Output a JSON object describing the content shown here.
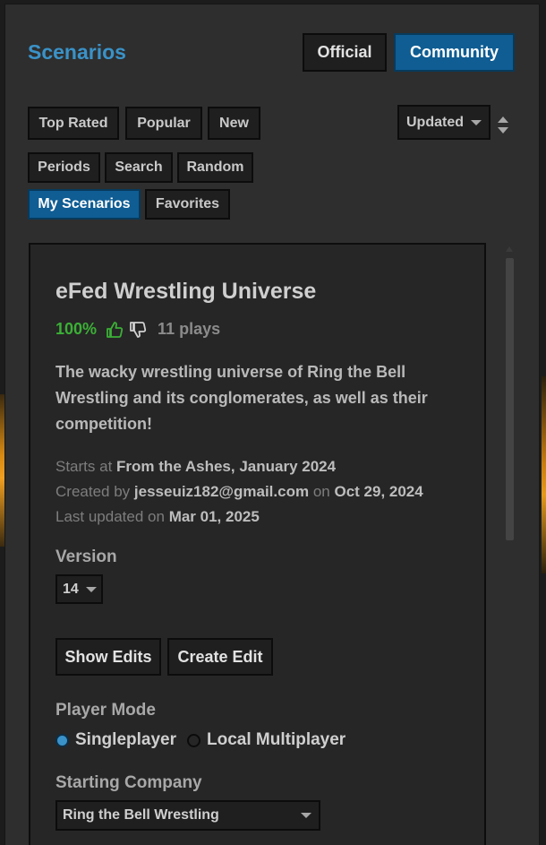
{
  "header": {
    "title": "Scenarios",
    "official_label": "Official",
    "community_label": "Community"
  },
  "filters": {
    "row1": [
      "Top Rated",
      "Popular",
      "New"
    ],
    "row2": [
      "Periods",
      "Search",
      "Random"
    ],
    "row3": [
      "My Scenarios",
      "Favorites"
    ],
    "sort_value": "Updated",
    "active": "My Scenarios"
  },
  "scenario": {
    "title": "eFed Wrestling Universe",
    "rating_percent": "100%",
    "plays": "11 plays",
    "description": "The wacky wrestling universe of Ring the Bell Wrestling and its conglomerates, as well as their competition!",
    "starts_at_label": "Starts at",
    "starts_at_value": "From the Ashes, January 2024",
    "created_by_label": "Created by",
    "created_by_value": "jesseuiz182@gmail.com",
    "on_label": "on",
    "created_date": "Oct 29, 2024",
    "last_updated_label": "Last updated on",
    "last_updated_value": "Mar 01, 2025",
    "version_label": "Version",
    "version_value": "14",
    "show_edits_label": "Show Edits",
    "create_edit_label": "Create Edit",
    "player_mode_label": "Player Mode",
    "singleplayer_label": "Singleplayer",
    "local_multiplayer_label": "Local Multiplayer",
    "selected_mode": "Singleplayer",
    "starting_company_label": "Starting Company",
    "starting_company_value": "Ring the Bell Wrestling"
  },
  "colors": {
    "accent": "#3a92c8",
    "active_button": "#0f5d93",
    "rating_green": "#3bb036"
  }
}
